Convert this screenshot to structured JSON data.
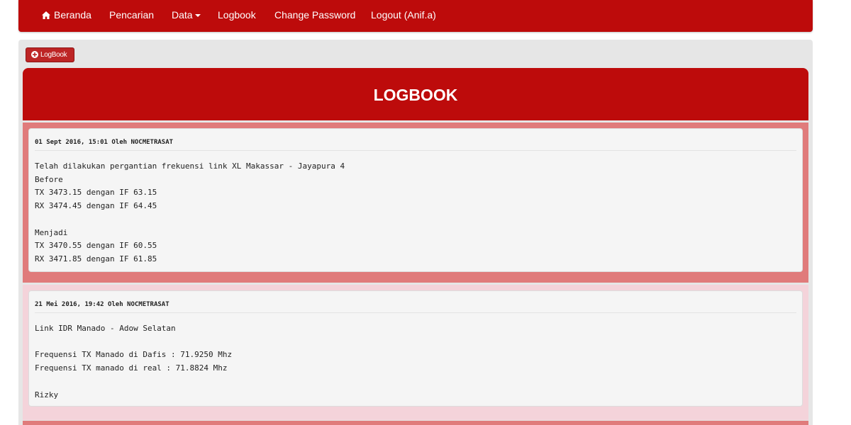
{
  "nav": {
    "home": "Beranda",
    "search": "Pencarian",
    "data": "Data",
    "logbook": "Logbook",
    "change_password": "Change Password",
    "logout": "Logout (Anif.a)"
  },
  "toolbar": {
    "logbook_button": "LogBook"
  },
  "header": {
    "title": "LOGBOOK"
  },
  "entries": [
    {
      "meta": "01 Sept 2016, 15:01 Oleh NOCMETRASAT",
      "body": "Telah dilakukan pergantian frekuensi link XL Makassar - Jayapura 4\nBefore\nTX 3473.15 dengan IF 63.15\nRX 3474.45 dengan IF 64.45\n\nMenjadi\nTX 3470.55 dengan IF 60.55\nRX 3471.85 dengan IF 61.85"
    },
    {
      "meta": "21 Mei 2016, 19:42 Oleh NOCMETRASAT",
      "body": "Link IDR Manado - Adow Selatan\n\nFrequensi TX Manado di Dafis : 71.9250 Mhz\nFrequensi TX manado di real : 71.8824 Mhz\n\nRizky"
    }
  ],
  "colors": {
    "brand": "#bd0b0b",
    "entry_bg_odd": "#e07b7b",
    "entry_bg_even": "#f4d3da"
  }
}
